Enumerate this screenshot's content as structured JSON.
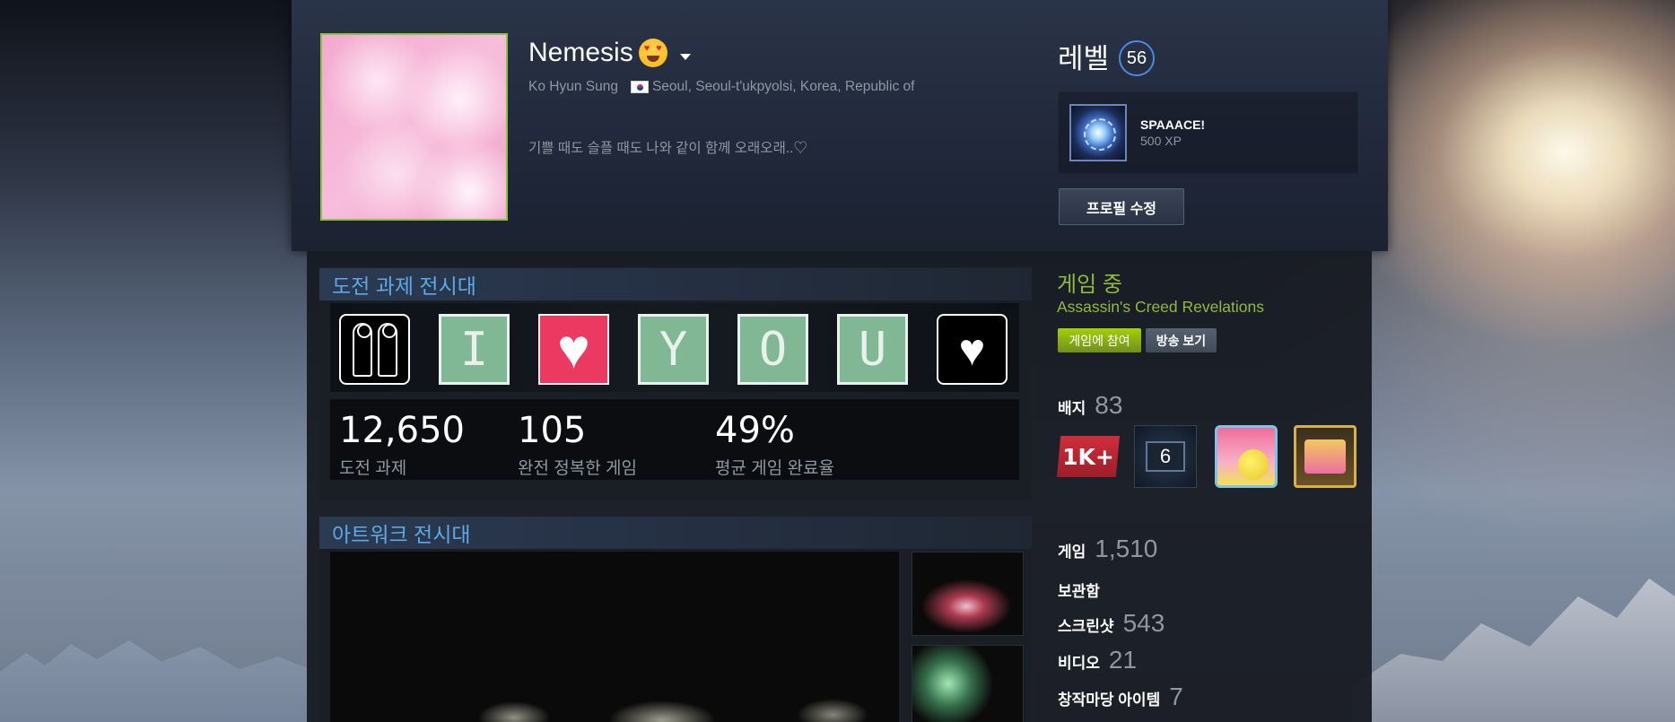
{
  "profile": {
    "persona_name": "Nemesis",
    "real_name": "Ko Hyun Sung",
    "location": "Seoul, Seoul-t'ukpyolsi, Korea, Republic of",
    "summary": "기쁠 때도 슬플 때도 나와 같이 함께 오래오래..♡",
    "level_label": "레벨",
    "level": "56",
    "favorite_badge": {
      "name": "SPAAACE!",
      "xp": "500 XP"
    },
    "edit_button": "프로필 수정"
  },
  "achievement_showcase": {
    "title": "도전 과제 전시대",
    "tiles": [
      {
        "type": "couple"
      },
      {
        "type": "letter",
        "text": "I"
      },
      {
        "type": "heart"
      },
      {
        "type": "letter",
        "text": "Y"
      },
      {
        "type": "letter",
        "text": "O"
      },
      {
        "type": "letter",
        "text": "U"
      },
      {
        "type": "pixel-heart"
      }
    ],
    "stats": [
      {
        "value": "12,650",
        "label": "도전 과제"
      },
      {
        "value": "105",
        "label": "완전 정복한 게임"
      },
      {
        "value": "49%",
        "label": "평균 게임 완료율"
      }
    ]
  },
  "artwork_showcase": {
    "title": "아트워크 전시대"
  },
  "sidebar": {
    "status": "게임 중",
    "game": "Assassin's Creed Revelations",
    "join_button": "게임에 참여",
    "watch_button": "방송 보기",
    "badges_label": "배지",
    "badges_count": "83",
    "badge_6_text": "6",
    "badge_1k_text": "1K+",
    "counts": [
      {
        "label": "게임",
        "value": "1,510"
      },
      {
        "label": "보관함",
        "value": ""
      },
      {
        "label": "스크린샷",
        "value": "543"
      },
      {
        "label": "비디오",
        "value": "21"
      },
      {
        "label": "창작마당 아이템",
        "value": "7"
      }
    ]
  }
}
